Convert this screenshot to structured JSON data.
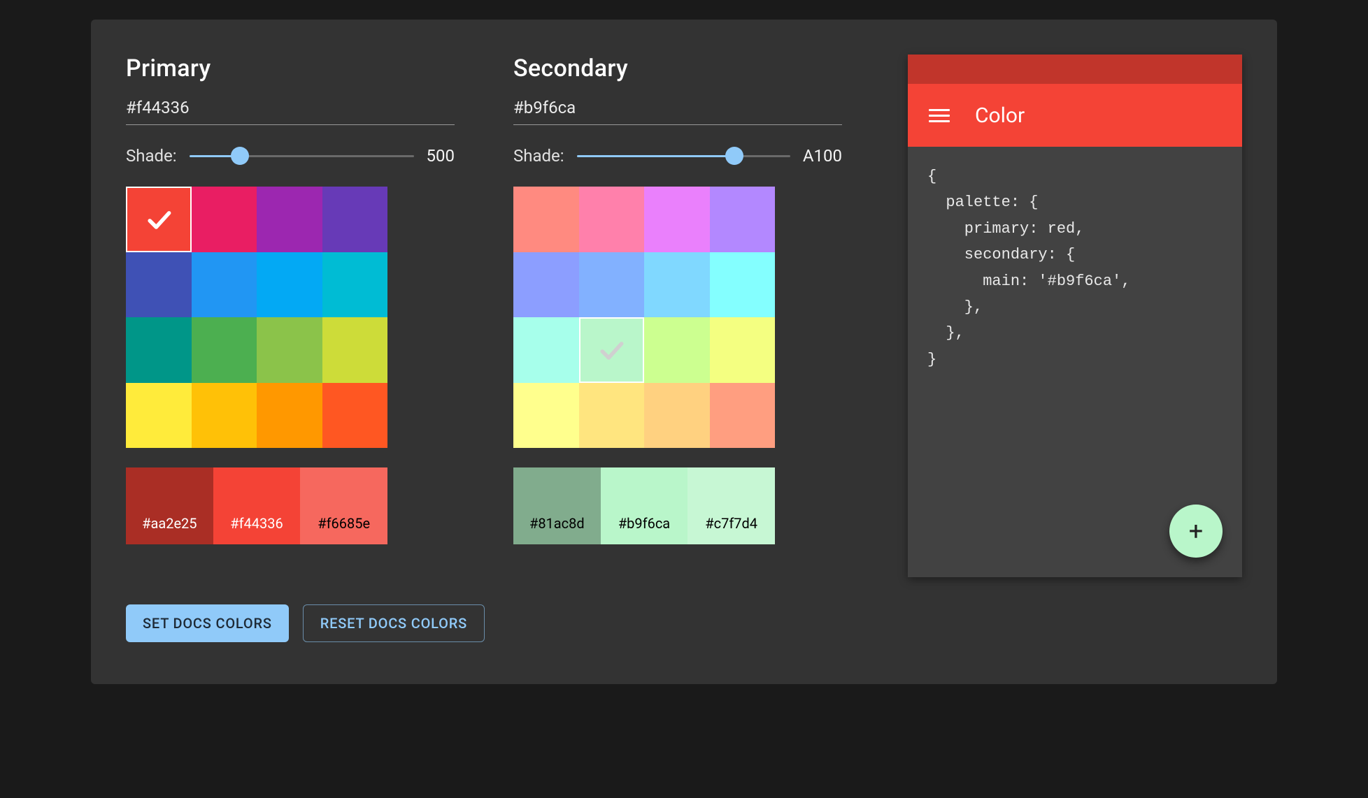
{
  "primary": {
    "title": "Primary",
    "hex": "#f44336",
    "shade_label": "Shade:",
    "shade_value": "500",
    "slider_percent": 20,
    "swatches": [
      {
        "color": "#f44336",
        "selected": true,
        "check": "#ffffff"
      },
      {
        "color": "#e91e63"
      },
      {
        "color": "#9c27b0"
      },
      {
        "color": "#673ab7"
      },
      {
        "color": "#3f51b5"
      },
      {
        "color": "#2196f3"
      },
      {
        "color": "#03a9f4"
      },
      {
        "color": "#00bcd4"
      },
      {
        "color": "#009688"
      },
      {
        "color": "#4caf50"
      },
      {
        "color": "#8bc34a"
      },
      {
        "color": "#cddc39"
      },
      {
        "color": "#ffeb3b"
      },
      {
        "color": "#ffc107"
      },
      {
        "color": "#ff9800"
      },
      {
        "color": "#ff5722"
      }
    ],
    "tints": [
      {
        "label": "#aa2e25",
        "bg": "#aa2e25",
        "fg": "#ffffff"
      },
      {
        "label": "#f44336",
        "bg": "#f44336",
        "fg": "#ffffff"
      },
      {
        "label": "#f6685e",
        "bg": "#f6685e",
        "fg": "#000000"
      }
    ]
  },
  "secondary": {
    "title": "Secondary",
    "hex": "#b9f6ca",
    "shade_label": "Shade:",
    "shade_value": "A100",
    "slider_percent": 76,
    "swatches": [
      {
        "color": "#ff8a80"
      },
      {
        "color": "#ff80ab"
      },
      {
        "color": "#ea80fc"
      },
      {
        "color": "#b388ff"
      },
      {
        "color": "#8c9eff"
      },
      {
        "color": "#82b1ff"
      },
      {
        "color": "#80d8ff"
      },
      {
        "color": "#84ffff"
      },
      {
        "color": "#a7ffeb"
      },
      {
        "color": "#b9f6ca",
        "selected": true,
        "check": "#d0d0d0"
      },
      {
        "color": "#ccff90"
      },
      {
        "color": "#f4ff81"
      },
      {
        "color": "#ffff8d"
      },
      {
        "color": "#ffe57f"
      },
      {
        "color": "#ffd180"
      },
      {
        "color": "#ff9e80"
      }
    ],
    "tints": [
      {
        "label": "#81ac8d",
        "bg": "#81ac8d",
        "fg": "#000000"
      },
      {
        "label": "#b9f6ca",
        "bg": "#b9f6ca",
        "fg": "#000000"
      },
      {
        "label": "#c7f7d4",
        "bg": "#c7f7d4",
        "fg": "#000000"
      }
    ]
  },
  "buttons": {
    "set": "Set Docs Colors",
    "reset": "Reset Docs Colors"
  },
  "preview": {
    "status_bg": "#c1352b",
    "appbar_bg": "#f44336",
    "appbar_title": "Color",
    "fab_bg": "#b9f6ca",
    "code": "{\n  palette: {\n    primary: red,\n    secondary: {\n      main: '#b9f6ca',\n    },\n  },\n}"
  }
}
